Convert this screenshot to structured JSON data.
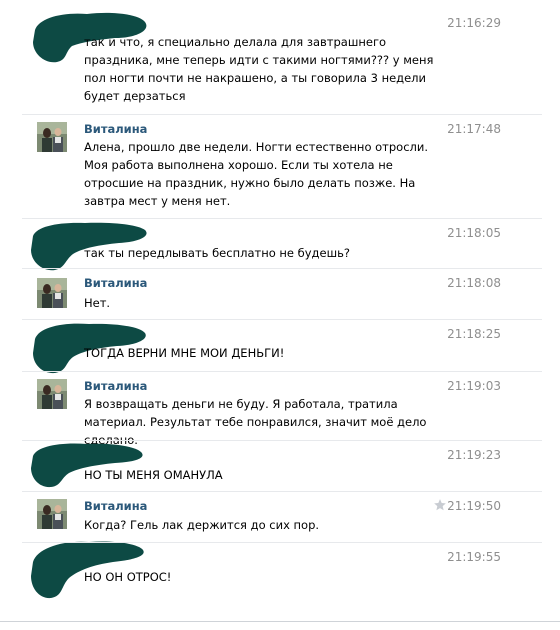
{
  "messages": [
    {
      "author": "",
      "time": "21:16:29",
      "text": "так и что, я специально делала для завтрашнего праздника, мне теперь идти с такими ногтями??? у меня пол ногти почти не накрашено, а ты говорила 3 недели будет дерзаться"
    },
    {
      "author": "Виталина",
      "time": "21:17:48",
      "text": "Алена, прошло две недели. Ногти естественно отросли. Моя работа выполнена хорошо. Если ты хотела не отросшие на праздник, нужно было делать позже. На завтра мест у меня нет."
    },
    {
      "author": "",
      "time": "21:18:05",
      "text": "так ты передлывать бесплатно не будешь?"
    },
    {
      "author": "Виталина",
      "time": "21:18:08",
      "text": "Нет."
    },
    {
      "author": "",
      "time": "21:18:25",
      "text": "ТОГДА ВЕРНИ МНЕ МОИ ДЕНЬГИ!"
    },
    {
      "author": "Виталина",
      "time": "21:19:03",
      "text": "Я возвращать деньги не буду. Я работала, тратила материал. Результат тебе понравился, значит моё дело сделано."
    },
    {
      "author": "",
      "time": "21:19:23",
      "text": "НО ТЫ МЕНЯ ОМАНУЛА"
    },
    {
      "author": "Виталина",
      "time": "21:19:50",
      "text": "Когда? Гель лак держится до сих пор.",
      "starred": true
    },
    {
      "author": "",
      "time": "21:19:55",
      "text": "НО ОН ОТРОС!"
    }
  ],
  "colors": {
    "author_name": "#2b587a",
    "time": "#8f8f8f",
    "redaction": "#0d4a44"
  },
  "icons": {
    "star": "star-icon"
  }
}
